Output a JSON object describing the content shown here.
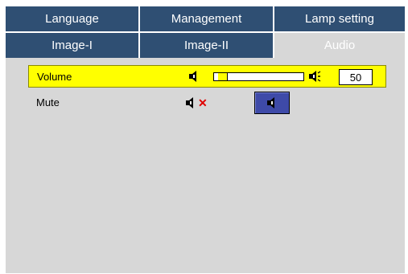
{
  "tabs_row1": [
    "Language",
    "Management",
    "Lamp setting"
  ],
  "tabs_row2": [
    "Image-I",
    "Image-II",
    "Audio"
  ],
  "active_tab": "Audio",
  "rows": {
    "volume": {
      "label": "Volume",
      "value": "50",
      "level": 0.05
    },
    "mute": {
      "label": "Mute",
      "selected_option": "speaker-on"
    }
  },
  "colors": {
    "tab_bg": "#2f4f73",
    "panel_bg": "#d7d7d7",
    "highlight": "#ffff00",
    "selected_button": "#3e4aa8"
  }
}
